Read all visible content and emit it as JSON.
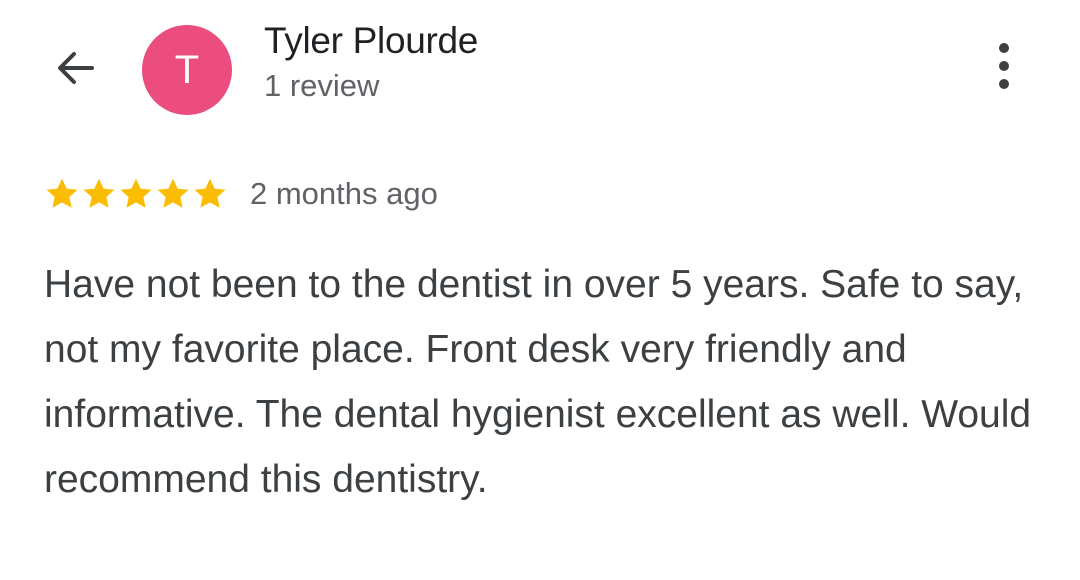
{
  "header": {
    "back_icon": "arrow-left-icon",
    "avatar_initial": "T",
    "avatar_color": "#ea4d7e",
    "reviewer_name": "Tyler Plourde",
    "review_count": "1 review",
    "more_icon": "more-vertical-icon"
  },
  "review": {
    "rating": 5,
    "rating_max": 5,
    "star_color": "#fbbc04",
    "time_ago": "2 months ago",
    "text": "Have not been to the dentist in over 5 years. Safe to say, not my favorite place. Front desk very friendly and informative. The dental hygienist excellent as well. Would recommend this dentistry."
  }
}
